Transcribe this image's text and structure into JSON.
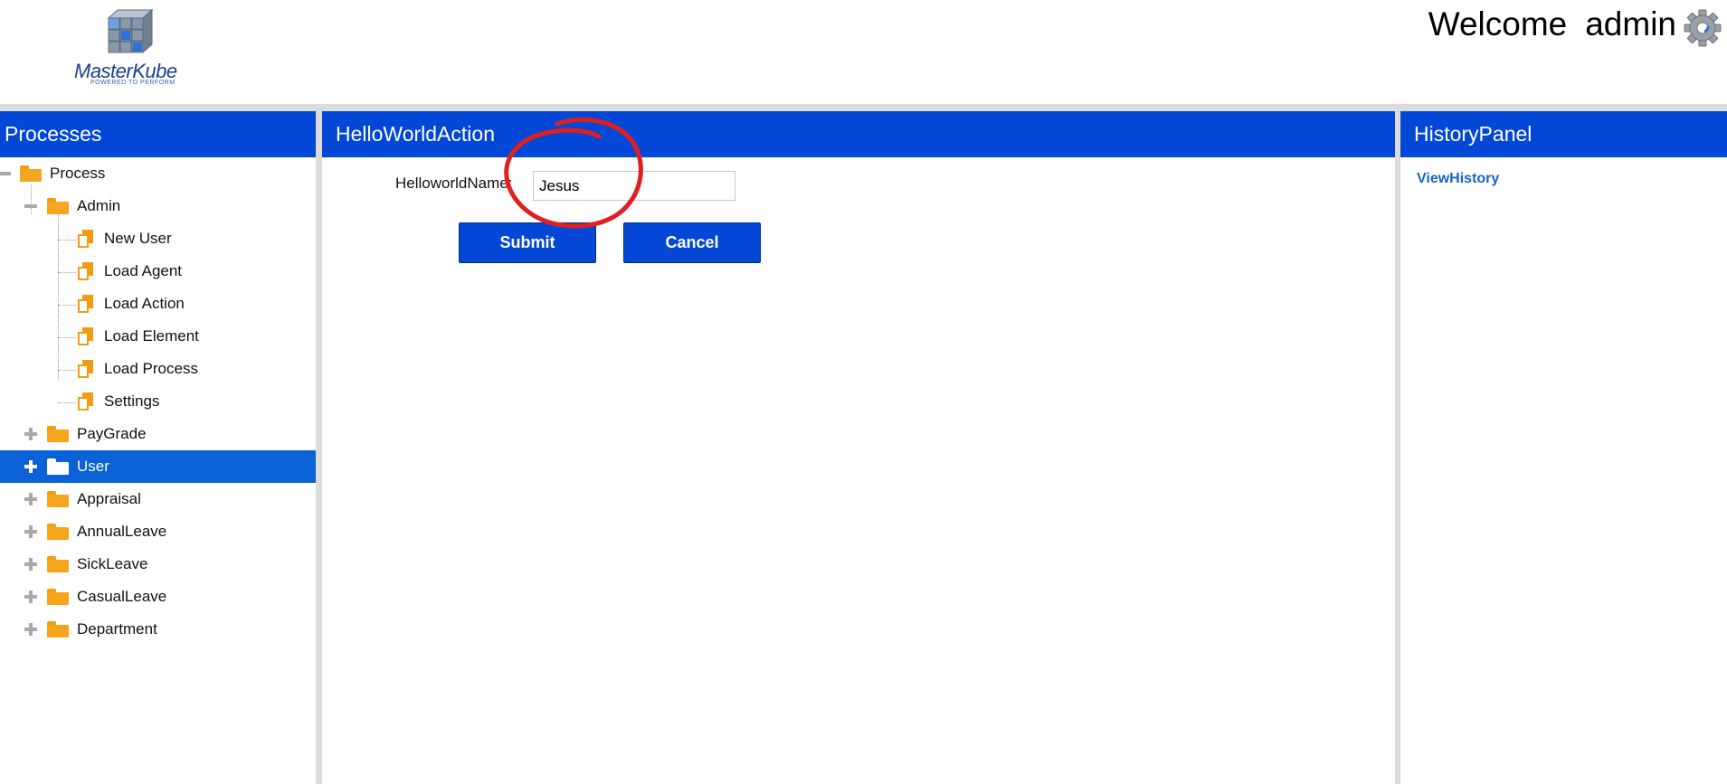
{
  "header": {
    "logo_text": "MasterKube",
    "logo_tagline": "POWERED TO PERFORM",
    "welcome_label": "Welcome",
    "username": "admin",
    "settings_icon": "gear-icon"
  },
  "processes_panel": {
    "title": "Processes",
    "tree": [
      {
        "label": "Process",
        "type": "folder",
        "expanded": true,
        "level": 0
      },
      {
        "label": "Admin",
        "type": "folder",
        "expanded": true,
        "level": 1
      },
      {
        "label": "New User",
        "type": "document",
        "level": 2
      },
      {
        "label": "Load Agent",
        "type": "document",
        "level": 2
      },
      {
        "label": "Load Action",
        "type": "document",
        "level": 2
      },
      {
        "label": "Load Element",
        "type": "document",
        "level": 2
      },
      {
        "label": "Load Process",
        "type": "document",
        "level": 2
      },
      {
        "label": "Settings",
        "type": "document",
        "level": 2
      },
      {
        "label": "PayGrade",
        "type": "folder",
        "expanded": false,
        "level": 1
      },
      {
        "label": "User",
        "type": "folder",
        "expanded": false,
        "level": 1,
        "selected": true
      },
      {
        "label": "Appraisal",
        "type": "folder",
        "expanded": false,
        "level": 1
      },
      {
        "label": "AnnualLeave",
        "type": "folder",
        "expanded": false,
        "level": 1
      },
      {
        "label": "SickLeave",
        "type": "folder",
        "expanded": false,
        "level": 1
      },
      {
        "label": "CasualLeave",
        "type": "folder",
        "expanded": false,
        "level": 1
      },
      {
        "label": "Department",
        "type": "folder",
        "expanded": false,
        "level": 1
      }
    ]
  },
  "action_panel": {
    "title": "HelloWorldAction",
    "field_label": "HelloworldName:",
    "field_value": "Jesus",
    "submit_label": "Submit",
    "cancel_label": "Cancel",
    "annotation_color": "#e02020"
  },
  "history_panel": {
    "title": "HistoryPanel",
    "link_label": "ViewHistory"
  },
  "colors": {
    "panel_header": "#0347d6",
    "selected_row": "#0a62d6",
    "folder": "#f7a61b",
    "link": "#1565c0"
  }
}
